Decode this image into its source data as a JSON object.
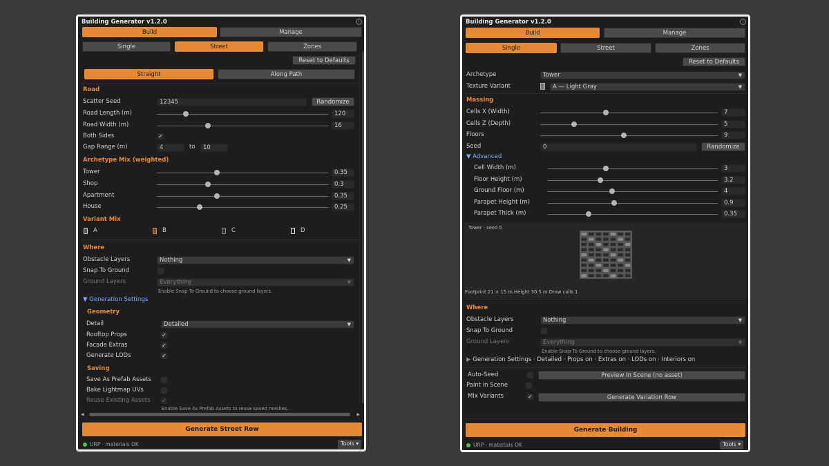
{
  "left": {
    "title": "Building Generator v1.2.0",
    "tabs": [
      "Build",
      "Manage"
    ],
    "subtabs": [
      "Single",
      "Street",
      "Zones"
    ],
    "reset_label": "Reset to Defaults",
    "path_tabs": [
      "Straight",
      "Along Path"
    ],
    "road": {
      "heading": "Road",
      "scatter_seed_label": "Scatter Seed",
      "scatter_seed_value": "12345",
      "randomize_label": "Randomize",
      "road_length_label": "Road Length (m)",
      "road_length_value": "120",
      "road_length_level": 0.17,
      "road_width_label": "Road Width (m)",
      "road_width_value": "16",
      "road_width_level": 0.3,
      "both_sides_label": "Both Sides",
      "gap_range_label": "Gap Range (m)",
      "gap_min": "4",
      "gap_to": "to",
      "gap_max": "10"
    },
    "archetype_mix": {
      "heading": "Archetype Mix (weighted)",
      "items": [
        {
          "label": "Tower",
          "value": "0.35",
          "level": 0.35
        },
        {
          "label": "Shop",
          "value": "0.3",
          "level": 0.3
        },
        {
          "label": "Apartment",
          "value": "0.35",
          "level": 0.35
        },
        {
          "label": "House",
          "value": "0.25",
          "level": 0.25
        }
      ]
    },
    "variant_mix": {
      "heading": "Variant Mix",
      "items": [
        "A",
        "B",
        "C",
        "D"
      ]
    },
    "where": {
      "heading": "Where",
      "obstacle_label": "Obstacle Layers",
      "obstacle_value": "Nothing",
      "snap_label": "Snap To Ground",
      "ground_label": "Ground Layers",
      "ground_value": "Everything",
      "hint": "Enable Snap To Ground to choose ground layers."
    },
    "generation": {
      "foldout": "Generation Settings",
      "geometry_heading": "Geometry",
      "detail_label": "Detail",
      "detail_value": "Detailed",
      "rooftop_label": "Rooftop Props",
      "facade_label": "Facade Extras",
      "lods_label": "Generate LODs",
      "saving_heading": "Saving",
      "save_prefab_label": "Save As Prefab Assets",
      "lightmap_label": "Bake Lightmap UVs",
      "reuse_label": "Reuse Existing Assets",
      "saving_hint": "Enable Save As Prefab Assets to reuse saved meshes."
    },
    "generate_label": "Generate Street Row",
    "status": "URP · materials OK",
    "tools_label": "Tools ▾"
  },
  "right": {
    "title": "Building Generator v1.2.0",
    "tabs": [
      "Build",
      "Manage"
    ],
    "subtabs": [
      "Single",
      "Street",
      "Zones"
    ],
    "reset_label": "Reset to Defaults",
    "archetype_label": "Archetype",
    "archetype_value": "Tower",
    "texture_label": "Texture Variant",
    "texture_value": "A — Light Gray",
    "massing": {
      "heading": "Massing",
      "items": [
        {
          "label": "Cells X (Width)",
          "value": "7",
          "level": 0.37
        },
        {
          "label": "Cells Z (Depth)",
          "value": "5",
          "level": 0.19
        },
        {
          "label": "Floors",
          "value": "9",
          "level": 0.47
        }
      ],
      "seed_label": "Seed",
      "seed_value": "0",
      "randomize_label": "Randomize"
    },
    "advanced": {
      "foldout": "Advanced",
      "items": [
        {
          "label": "Cell Width (m)",
          "value": "3",
          "level": 0.34
        },
        {
          "label": "Floor Height (m)",
          "value": "3.2",
          "level": 0.31
        },
        {
          "label": "Ground Floor (m)",
          "value": "4",
          "level": 0.38
        },
        {
          "label": "Parapet Height (m)",
          "value": "0.9",
          "level": 0.39
        },
        {
          "label": "Parapet Thick (m)",
          "value": "0.35",
          "level": 0.24
        }
      ]
    },
    "preview": {
      "caption": "Tower · seed 0",
      "footer": "Footprint 21 × 15 m  Height 30.5 m  Draw calls 1"
    },
    "where": {
      "heading": "Where",
      "obstacle_label": "Obstacle Layers",
      "obstacle_value": "Nothing",
      "snap_label": "Snap To Ground",
      "ground_label": "Ground Layers",
      "ground_value": "Everything",
      "hint": "Enable Snap To Ground to choose ground layers."
    },
    "gen_summary": "Generation Settings · Detailed · Props on · Extras on · LODs on · Interiors on",
    "auto_seed_label": "Auto-Seed",
    "preview_btn": "Preview In Scene (no asset)",
    "paint_label": "Paint in Scene",
    "mix_label": "Mix Variants",
    "variation_btn": "Generate Variation Row",
    "generate_label": "Generate Building",
    "status": "URP · materials OK",
    "tools_label": "Tools ▾"
  }
}
